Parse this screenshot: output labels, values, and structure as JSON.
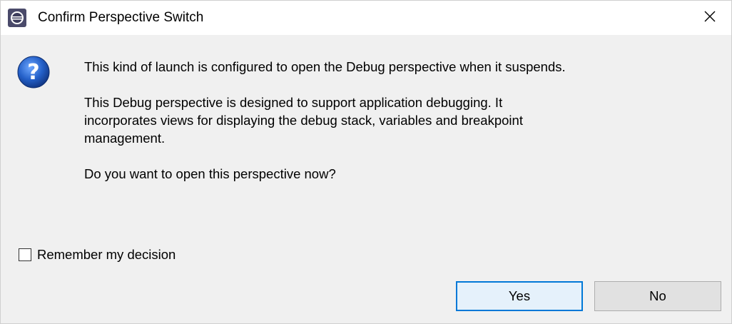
{
  "dialog": {
    "title": "Confirm Perspective Switch",
    "app_icon": "eclipse-icon",
    "close_icon": "close-icon"
  },
  "message": {
    "icon": "question-icon",
    "line1": "This kind of launch is configured to open the Debug perspective when it suspends.",
    "line2": "This Debug perspective is designed to support application debugging.  It\nincorporates views for displaying the debug stack, variables and breakpoint\nmanagement.",
    "line3": "Do you want to open this perspective now?"
  },
  "remember": {
    "label": "Remember my decision",
    "checked": false
  },
  "buttons": {
    "yes": "Yes",
    "no": "No"
  },
  "colors": {
    "accent": "#0078d7",
    "dialog_bg": "#f0f0f0",
    "titlebar_bg": "#ffffff"
  }
}
